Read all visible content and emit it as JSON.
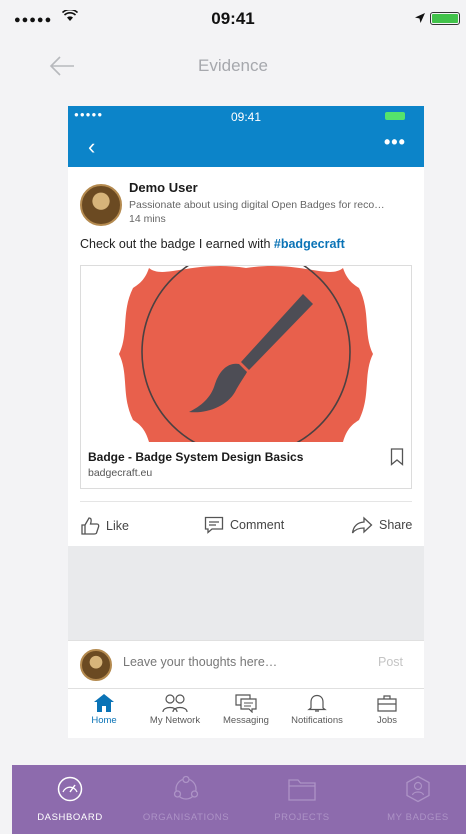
{
  "status_bar": {
    "time": "09:41",
    "signal": "●●●●●"
  },
  "header": {
    "title": "Evidence"
  },
  "evidence": {
    "status_time": "09:41",
    "signal": "●●●●● ",
    "more_label": "•••",
    "post": {
      "author": "Demo User",
      "headline": "Passionate about using digital Open Badges for reco…",
      "time": "14 mins",
      "text": "Check out the badge I earned with ",
      "hashtag": "#badgecraft",
      "card_title": "Badge - Badge System Design Basics",
      "card_url": "badgecraft.eu",
      "badge_color": "#e8604c"
    },
    "actions": {
      "like": "Like",
      "comment": "Comment",
      "share": "Share"
    },
    "comment": {
      "placeholder": "Leave your thoughts here…",
      "post": "Post"
    },
    "tabs": [
      {
        "label": "Home",
        "icon": "home-icon",
        "active": true
      },
      {
        "label": "My Network",
        "icon": "network-icon"
      },
      {
        "label": "Messaging",
        "icon": "messaging-icon"
      },
      {
        "label": "Notifications",
        "icon": "bell-icon"
      },
      {
        "label": "Jobs",
        "icon": "briefcase-icon"
      }
    ],
    "accent": "#0c84c9"
  },
  "bottom_nav": {
    "items": [
      {
        "label": "DASHBOARD",
        "icon": "dashboard-gauge-icon",
        "active": true
      },
      {
        "label": "ORGANISATIONS",
        "icon": "organisations-icon"
      },
      {
        "label": "PROJECTS",
        "icon": "folder-icon"
      },
      {
        "label": "MY BADGES",
        "icon": "badge-icon"
      }
    ],
    "color": "#8d6bad"
  }
}
